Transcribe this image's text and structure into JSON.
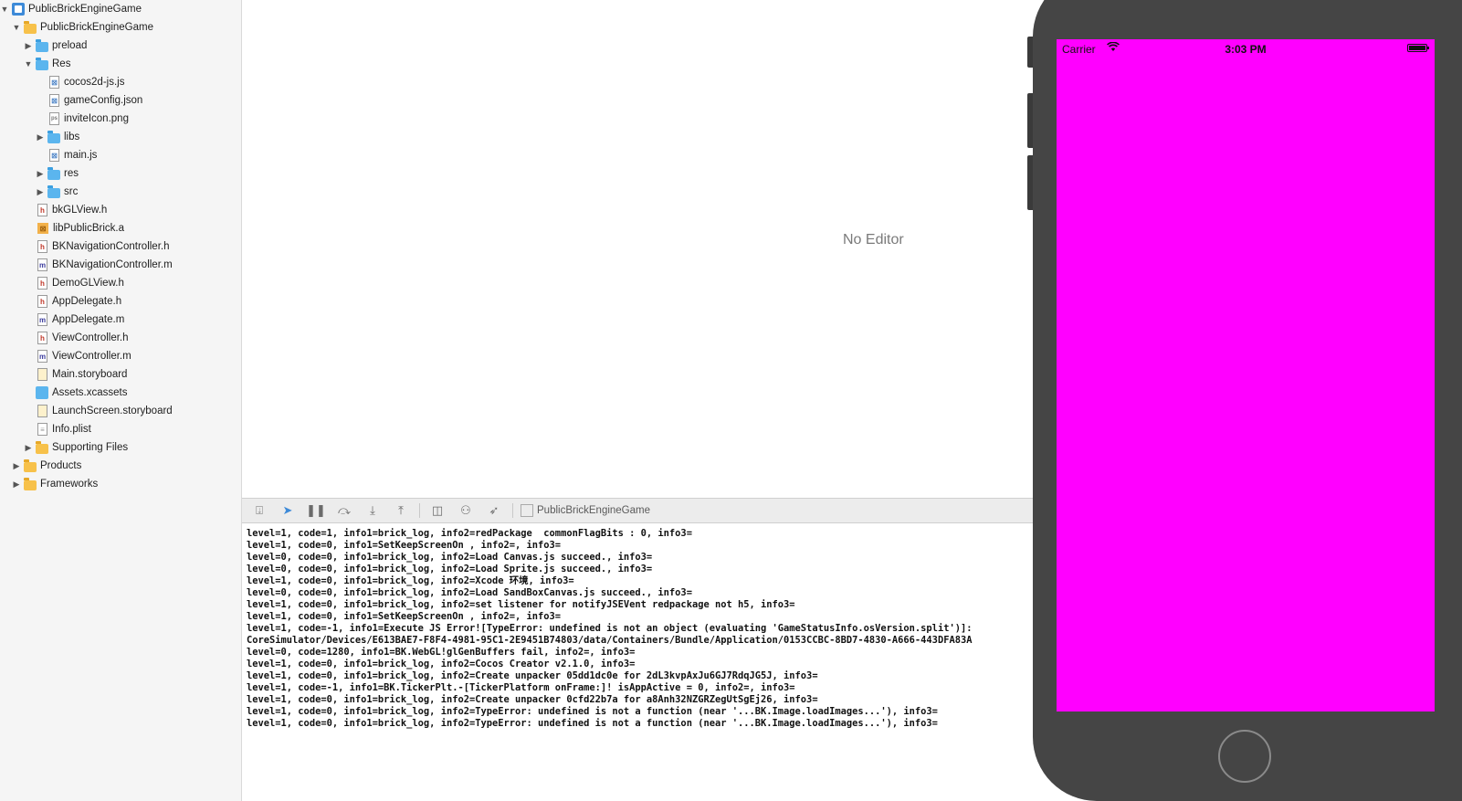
{
  "navigator": {
    "items": [
      {
        "label": "PublicBrickEngineGame",
        "icon": "project-icon",
        "depth": 0,
        "disclosure": "open"
      },
      {
        "label": "PublicBrickEngineGame",
        "icon": "folder-yellow-icon",
        "depth": 1,
        "disclosure": "open"
      },
      {
        "label": "preload",
        "icon": "folder-blue-icon",
        "depth": 2,
        "disclosure": "closed"
      },
      {
        "label": "Res",
        "icon": "folder-blue-icon",
        "depth": 2,
        "disclosure": "open"
      },
      {
        "label": "cocos2d-js.js",
        "icon": "js-file-icon",
        "depth": 3,
        "disclosure": "none"
      },
      {
        "label": "gameConfig.json",
        "icon": "js-file-icon",
        "depth": 3,
        "disclosure": "none"
      },
      {
        "label": "inviteIcon.png",
        "icon": "image-file-icon",
        "depth": 3,
        "disclosure": "none"
      },
      {
        "label": "libs",
        "icon": "folder-blue-icon",
        "depth": 3,
        "disclosure": "closed"
      },
      {
        "label": "main.js",
        "icon": "js-file-icon",
        "depth": 3,
        "disclosure": "none"
      },
      {
        "label": "res",
        "icon": "folder-blue-icon",
        "depth": 3,
        "disclosure": "closed"
      },
      {
        "label": "src",
        "icon": "folder-blue-icon",
        "depth": 3,
        "disclosure": "closed"
      },
      {
        "label": "bkGLView.h",
        "icon": "header-file-icon",
        "depth": 2,
        "disclosure": "none"
      },
      {
        "label": "libPublicBrick.a",
        "icon": "library-file-icon",
        "depth": 2,
        "disclosure": "none"
      },
      {
        "label": "BKNavigationController.h",
        "icon": "header-file-icon",
        "depth": 2,
        "disclosure": "none"
      },
      {
        "label": "BKNavigationController.m",
        "icon": "objc-file-icon",
        "depth": 2,
        "disclosure": "none"
      },
      {
        "label": "DemoGLView.h",
        "icon": "header-file-icon",
        "depth": 2,
        "disclosure": "none"
      },
      {
        "label": "AppDelegate.h",
        "icon": "header-file-icon",
        "depth": 2,
        "disclosure": "none"
      },
      {
        "label": "AppDelegate.m",
        "icon": "objc-file-icon",
        "depth": 2,
        "disclosure": "none"
      },
      {
        "label": "ViewController.h",
        "icon": "header-file-icon",
        "depth": 2,
        "disclosure": "none"
      },
      {
        "label": "ViewController.m",
        "icon": "objc-file-icon",
        "depth": 2,
        "disclosure": "none"
      },
      {
        "label": "Main.storyboard",
        "icon": "storyboard-file-icon",
        "depth": 2,
        "disclosure": "none"
      },
      {
        "label": "Assets.xcassets",
        "icon": "assets-icon",
        "depth": 2,
        "disclosure": "none"
      },
      {
        "label": "LaunchScreen.storyboard",
        "icon": "storyboard-file-icon",
        "depth": 2,
        "disclosure": "none"
      },
      {
        "label": "Info.plist",
        "icon": "plist-file-icon",
        "depth": 2,
        "disclosure": "none"
      },
      {
        "label": "Supporting Files",
        "icon": "folder-yellow-icon",
        "depth": 2,
        "disclosure": "closed"
      },
      {
        "label": "Products",
        "icon": "folder-yellow-icon",
        "depth": 1,
        "disclosure": "closed"
      },
      {
        "label": "Frameworks",
        "icon": "folder-yellow-icon",
        "depth": 1,
        "disclosure": "closed"
      }
    ]
  },
  "editor": {
    "placeholder": "No Editor"
  },
  "debug_bar": {
    "target": "PublicBrickEngineGame"
  },
  "console": {
    "lines": [
      "level=1, code=1, info1=brick_log, info2=redPackage  commonFlagBits : 0, info3=",
      "level=1, code=0, info1=SetKeepScreenOn , info2=, info3=",
      "level=0, code=0, info1=brick_log, info2=Load Canvas.js succeed., info3=",
      "level=0, code=0, info1=brick_log, info2=Load Sprite.js succeed., info3=",
      "level=1, code=0, info1=brick_log, info2=Xcode 环境, info3=",
      "level=0, code=0, info1=brick_log, info2=Load SandBoxCanvas.js succeed., info3=",
      "level=1, code=0, info1=brick_log, info2=set listener for notifyJSEVent redpackage not h5, info3=",
      "level=1, code=0, info1=SetKeepScreenOn , info2=, info3=",
      "level=1, code=-1, info1=Execute JS Error![TypeError: undefined is not an object (evaluating 'GameStatusInfo.osVersion.split')]:",
      "CoreSimulator/Devices/E613BAE7-F8F4-4981-95C1-2E9451B74803/data/Containers/Bundle/Application/0153CCBC-8BD7-4830-A666-443DFA83A",
      "level=0, code=1280, info1=BK.WebGL!glGenBuffers fail, info2=, info3=",
      "level=1, code=0, info1=brick_log, info2=Cocos Creator v2.1.0, info3=",
      "level=1, code=0, info1=brick_log, info2=Create unpacker 05dd1dc0e for 2dL3kvpAxJu6GJ7RdqJG5J, info3=",
      "level=1, code=-1, info1=BK.TickerPlt.-[TickerPlatform onFrame:]! isAppActive = 0, info2=, info3=",
      "level=1, code=0, info1=brick_log, info2=Create unpacker 0cfd22b7a for a8Anh32NZGRZegUtSgEj26, info3=",
      "level=1, code=0, info1=brick_log, info2=TypeError: undefined is not a function (near '...BK.Image.loadImages...'), info3=",
      "level=1, code=0, info1=brick_log, info2=TypeError: undefined is not a function (near '...BK.Image.loadImages...'), info3="
    ]
  },
  "simulator": {
    "carrier": "Carrier",
    "time": "3:03 PM",
    "battery_level": 1.0,
    "screen_color": "#ff00ff"
  }
}
